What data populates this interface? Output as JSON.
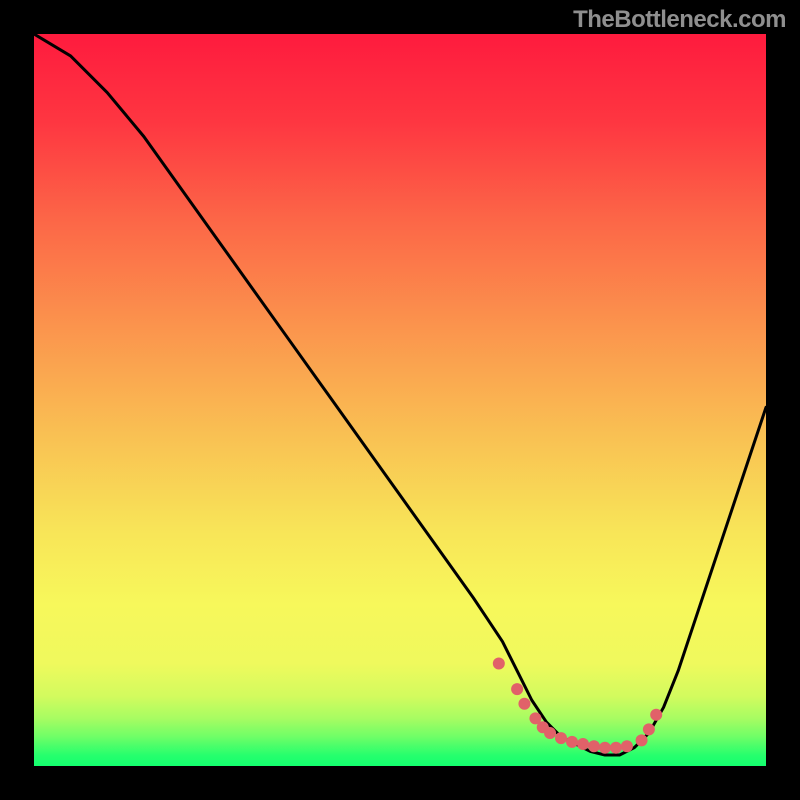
{
  "watermark": "TheBottleneck.com",
  "colors": {
    "curve": "#000000",
    "marker": "#e16169",
    "gradient_stops": [
      {
        "offset": 0.0,
        "color": "#fe1b3e"
      },
      {
        "offset": 0.12,
        "color": "#fe3641"
      },
      {
        "offset": 0.25,
        "color": "#fc6547"
      },
      {
        "offset": 0.4,
        "color": "#fb944d"
      },
      {
        "offset": 0.55,
        "color": "#f9c153"
      },
      {
        "offset": 0.68,
        "color": "#f8e558"
      },
      {
        "offset": 0.78,
        "color": "#f7f85b"
      },
      {
        "offset": 0.86,
        "color": "#eff95d"
      },
      {
        "offset": 0.905,
        "color": "#d2fb5e"
      },
      {
        "offset": 0.935,
        "color": "#a7fc62"
      },
      {
        "offset": 0.96,
        "color": "#6ffe67"
      },
      {
        "offset": 0.985,
        "color": "#27ff6d"
      },
      {
        "offset": 1.0,
        "color": "#13ff6e"
      }
    ]
  },
  "chart_data": {
    "type": "line",
    "title": "",
    "xlabel": "",
    "ylabel": "",
    "xlim": [
      0,
      100
    ],
    "ylim": [
      0,
      100
    ],
    "grid": false,
    "legend": false,
    "series": [
      {
        "name": "bottleneck-curve",
        "x": [
          0,
          5,
          10,
          15,
          20,
          25,
          30,
          35,
          40,
          45,
          50,
          55,
          60,
          62,
          64,
          66,
          68,
          70,
          72,
          74,
          76,
          78,
          80,
          82,
          84,
          86,
          88,
          90,
          92,
          94,
          96,
          98,
          100
        ],
        "values": [
          100,
          97,
          92,
          86,
          79,
          72,
          65,
          58,
          51,
          44,
          37,
          30,
          23,
          20,
          17,
          13,
          9,
          6,
          4,
          3,
          2,
          1.5,
          1.5,
          2.5,
          4.5,
          8,
          13,
          19,
          25,
          31,
          37,
          43,
          49
        ]
      }
    ],
    "markers": {
      "name": "flat-region-markers",
      "x": [
        63.5,
        66,
        67,
        68.5,
        69.5,
        70.5,
        72,
        73.5,
        75,
        76.5,
        78,
        79.5,
        81,
        83,
        84,
        85
      ],
      "values": [
        14,
        10.5,
        8.5,
        6.5,
        5.3,
        4.5,
        3.8,
        3.3,
        3.0,
        2.7,
        2.5,
        2.5,
        2.7,
        3.5,
        5,
        7
      ]
    }
  }
}
